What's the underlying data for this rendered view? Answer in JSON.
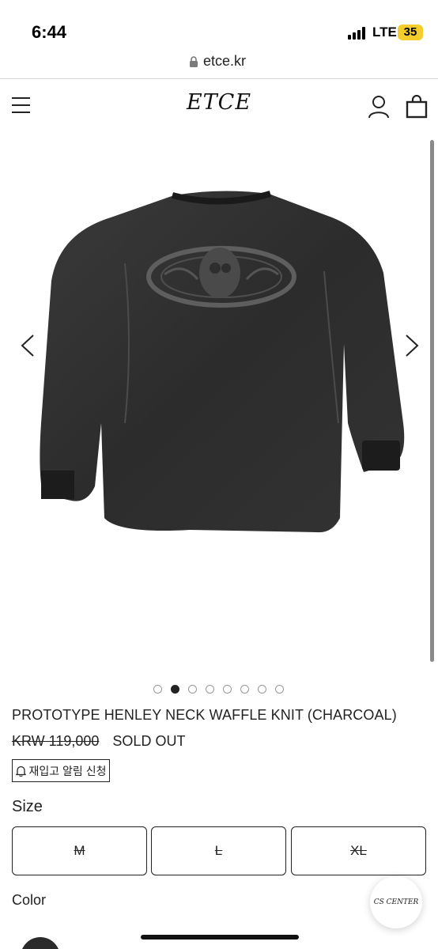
{
  "status_bar": {
    "time": "6:44",
    "network": "LTE",
    "battery": "35",
    "battery_color": "#f4cc2b"
  },
  "browser": {
    "url": "etce.kr"
  },
  "header": {
    "brand": "ETCE",
    "icons": [
      "menu-icon",
      "user-icon",
      "shopping-bag-icon"
    ]
  },
  "carousel": {
    "image_count": 8,
    "active_index": 1,
    "prev_icon": "chevron-left-icon",
    "next_icon": "chevron-right-icon"
  },
  "product": {
    "title": "PROTOTYPE HENLEY NECK WAFFLE KNIT (CHARCOAL)",
    "price": "KRW 119,000",
    "status": "SOLD OUT",
    "restock_label": "재입고 알림 신청"
  },
  "options": {
    "size_label": "Size",
    "sizes": [
      "M",
      "L",
      "XL"
    ],
    "color_label": "Color",
    "swatch_color": "#2b2b2b"
  },
  "cs_center": {
    "label": "CS CENTER"
  }
}
